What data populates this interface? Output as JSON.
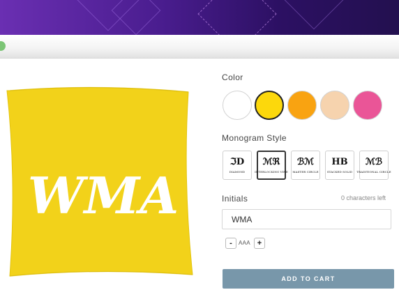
{
  "product": {
    "image_alt_icon": "pillow-image",
    "pillow_color": "#f2d21a",
    "monogram_text": "WMA"
  },
  "color_section": {
    "label": "Color",
    "swatches": [
      {
        "name": "white",
        "color": "#ffffff",
        "selected": false
      },
      {
        "name": "yellow",
        "color": "#fcd80c",
        "selected": true
      },
      {
        "name": "orange",
        "color": "#f9a311",
        "selected": false
      },
      {
        "name": "peach",
        "color": "#f6d3ae",
        "selected": false
      },
      {
        "name": "pink",
        "color": "#ea5597",
        "selected": false
      }
    ]
  },
  "monogram_section": {
    "label": "Monogram Style",
    "styles": [
      {
        "mono": "ℑD",
        "caption": "DIAMOND",
        "selected": false
      },
      {
        "mono": "ℳℜ",
        "caption": "INTERLOCKING VINE",
        "selected": true
      },
      {
        "mono": "ℬℳ",
        "caption": "MASTER CIRCLE",
        "selected": false
      },
      {
        "mono": "HB",
        "caption": "STACKED SOLID",
        "selected": false
      },
      {
        "mono": "ℳℬ",
        "caption": "TRADITIONAL CIRCLE",
        "selected": false
      }
    ]
  },
  "initials_section": {
    "label": "Initials",
    "chars_left": "0 characters left",
    "value": "WMA",
    "minus": "-",
    "plus": "+",
    "size_label": "AAA"
  },
  "cart": {
    "button_label": "ADD TO CART",
    "button_color": "#7897aa"
  }
}
